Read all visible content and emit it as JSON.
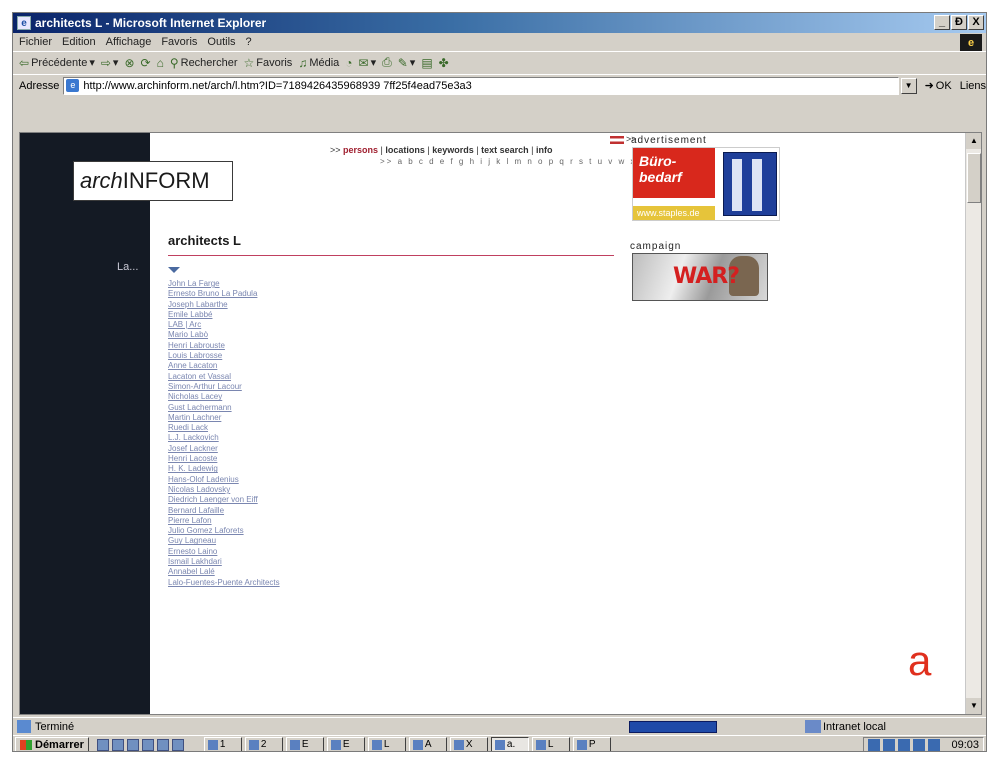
{
  "window": {
    "title": "architects L - Microsoft Internet Explorer",
    "icon_name": "ie-page-icon",
    "controls": {
      "minimize": "_",
      "restore": "Ɖ",
      "close": "X"
    }
  },
  "menu": {
    "items": [
      "Fichier",
      "Edition",
      "Affichage",
      "Favoris",
      "Outils",
      "?"
    ]
  },
  "toolbar": {
    "back": "Précédente",
    "search": "Rechercher",
    "favorites": "Favoris",
    "media": "Média"
  },
  "address": {
    "label": "Adresse",
    "url": "http://www.archinform.net/arch/l.htm?ID=7189426435968939 7ff25f4ead75e3a3",
    "go": "OK",
    "links": "Liens"
  },
  "site": {
    "logo_prefix": "arch",
    "logo_suffix": "INFORM",
    "sidebar_label": "La...",
    "nav": {
      "prefix": ">>",
      "persons": "persons",
      "locations": "locations",
      "keywords": "keywords",
      "text_search": "text search",
      "info": "info"
    },
    "alphabet": ">> a b c d e f g h i j k l m n o p q r s t u v w x y z",
    "flag_arrows": ">>",
    "page_title": "architects L",
    "architects": [
      "John La Farge",
      "Ernesto Bruno La Padula",
      "Joseph Labarthe",
      "Emile Labbé",
      "LAB | Arc",
      "Mario Labò",
      "Henri Labrouste",
      "Louis Labrosse",
      "Anne Lacaton",
      "Lacaton et Vassal",
      "Simon-Arthur Lacour",
      "Nicholas Lacey",
      "Gust Lachermann",
      "Martin Lachner",
      "Ruedi Lack",
      "L.J. Lackovich",
      "Josef Lackner",
      "Henri Lacoste",
      "H. K. Ladewig",
      "Hans-Olof Ladenius",
      "Nicolas Ladovsky",
      "Diedrich Laenger von Eiff",
      "Bernard Lafaille",
      "Pierre Lafon",
      "Julio Gomez Laforets",
      "Guy Lagneau",
      "Ernesto Laino",
      "Ismail Lakhdari",
      "Annabel Lalé",
      "Lalo-Fuentes-Puente Architects"
    ],
    "advertisement_label": "advertisement",
    "ad": {
      "headline_1": "Büro-",
      "headline_2": "bedarf",
      "url": "www.staples.de"
    },
    "campaign_label": "campaign",
    "campaign_text": "WAR?"
  },
  "overlay_letter": "a",
  "status": {
    "text": "Terminé",
    "zone": "Intranet local"
  },
  "taskbar": {
    "start": "Démarrer",
    "tasks": [
      "1",
      "2",
      "E",
      "E",
      "L",
      "A",
      "X",
      "a.",
      "L",
      "P"
    ],
    "clock": "09:03"
  },
  "colors": {
    "title_gradient_start": "#0a246a",
    "accent_red": "#d8281c",
    "nav_active": "#a02030",
    "link_color": "#7a86b0",
    "left_band": "#141a24"
  }
}
